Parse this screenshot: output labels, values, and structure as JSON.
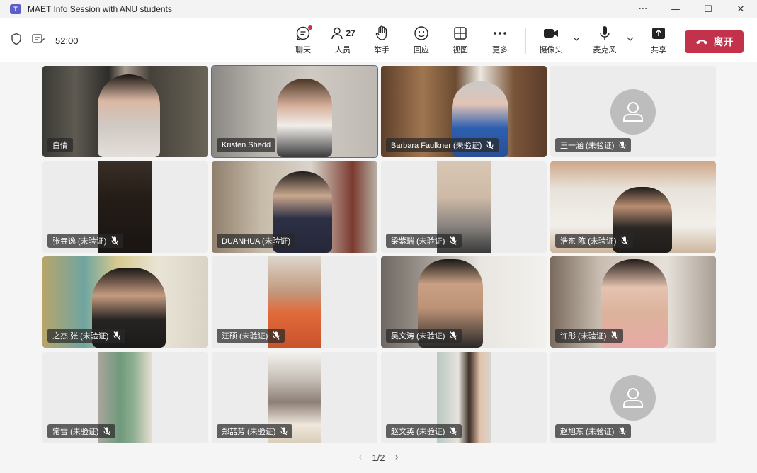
{
  "window": {
    "title": "MAET Info Session with ANU students",
    "controls": [
      "···",
      "—",
      "☐",
      "✕"
    ]
  },
  "toolbar": {
    "timer": "52:00",
    "chat_label": "聊天",
    "people_label": "人员",
    "people_count": "27",
    "raise_hand_label": "举手",
    "react_label": "回应",
    "view_label": "视图",
    "more_label": "更多",
    "camera_label": "摄像头",
    "mic_label": "麦克风",
    "share_label": "共享",
    "leave_label": "离开"
  },
  "participants": [
    {
      "name": "白倩",
      "muted": false
    },
    {
      "name": "Kristen Shedd",
      "muted": false
    },
    {
      "name": "Barbara Faulkner (未验证)",
      "muted": true
    },
    {
      "name": "王一涵 (未验证)",
      "muted": true
    },
    {
      "name": "张垚逸 (未验证)",
      "muted": true
    },
    {
      "name": "DUANHUA (未验证)",
      "muted": false
    },
    {
      "name": "梁紫瑞 (未验证)",
      "muted": true
    },
    {
      "name": "浩东 陈 (未验证)",
      "muted": true
    },
    {
      "name": "之杰 张 (未验证)",
      "muted": true
    },
    {
      "name": "汪硕 (未验证)",
      "muted": true
    },
    {
      "name": "吴文涛 (未验证)",
      "muted": true
    },
    {
      "name": "许彤 (未验证)",
      "muted": true
    },
    {
      "name": "常雪 (未验证)",
      "muted": true
    },
    {
      "name": "郑喆芳 (未验证)",
      "muted": true
    },
    {
      "name": "赵文英 (未验证)",
      "muted": true
    },
    {
      "name": "赵旭东 (未验证)",
      "muted": true
    }
  ],
  "pager": {
    "label": "1/2",
    "prev": "‹",
    "next": "›"
  }
}
